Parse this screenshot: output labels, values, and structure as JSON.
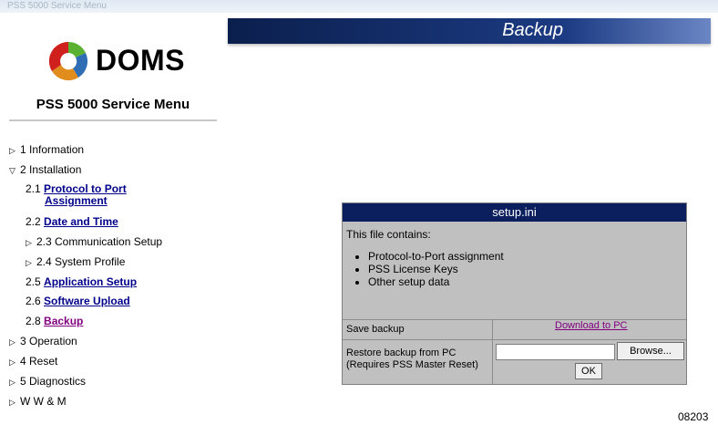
{
  "browser": {
    "strip_text": "PSS 5000 Service Menu"
  },
  "brand": {
    "name": "DOMS",
    "service_menu_title": "PSS 5000 Service Menu"
  },
  "nav": {
    "information": "1 Information",
    "installation": "2 Installation",
    "sub": {
      "protocol_prefix": "2.1",
      "protocol_line1": "Protocol to Port",
      "protocol_line2": "Assignment",
      "date_prefix": "2.2",
      "date_label": "Date and Time",
      "comm_label": "2.3 Communication Setup",
      "system_label": "2.4 System Profile",
      "app_prefix": "2.5",
      "app_label": "Application Setup",
      "software_prefix": "2.6",
      "software_label": "Software Upload",
      "backup_prefix": "2.8",
      "backup_label": "Backup"
    },
    "operation": "3 Operation",
    "reset": "4 Reset",
    "diagnostics": "5 Diagnostics",
    "wwm": "W W & M"
  },
  "page": {
    "title": "Backup"
  },
  "panel": {
    "file_name": "setup.ini",
    "intro": "This file contains:",
    "items": [
      "Protocol-to-Port assignment",
      "PSS License Keys",
      "Other setup data"
    ],
    "save_label": "Save backup",
    "download_label": "Download to PC",
    "restore_line1": "Restore backup from PC",
    "restore_line2": "(Requires PSS Master Reset)",
    "browse_label": "Browse...",
    "ok_label": "OK"
  },
  "figure_code": "08203",
  "colors": {
    "header_navy": "#0b1f4d",
    "link_blue": "#00008b",
    "visited_purple": "#800080",
    "panel_gray": "#c0c0c0"
  }
}
